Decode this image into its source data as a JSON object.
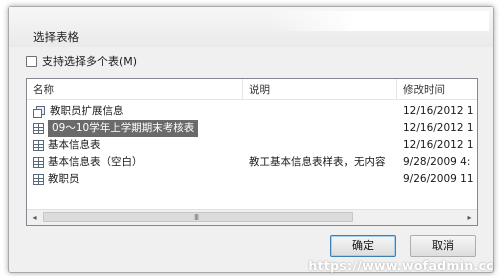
{
  "dialog": {
    "title": "选择表格",
    "multi_select_label": "支持选择多个表(M)",
    "multi_select_checked": false
  },
  "list": {
    "columns": [
      "名称",
      "说明",
      "修改时间"
    ],
    "rows": [
      {
        "icon": "linked-table-icon",
        "name": "教职员扩展信息",
        "desc": "",
        "modified": "12/16/2012 1",
        "selected": false
      },
      {
        "icon": "table-icon",
        "name": "09～10学年上学期期末考核表",
        "desc": "",
        "modified": "12/16/2012 1",
        "selected": true
      },
      {
        "icon": "table-icon",
        "name": "基本信息表",
        "desc": "",
        "modified": "12/16/2012 1",
        "selected": false
      },
      {
        "icon": "table-icon",
        "name": "基本信息表（空白）",
        "desc": "教工基本信息表样表，无内容",
        "modified": "9/28/2009 4:",
        "selected": false
      },
      {
        "icon": "table-icon",
        "name": "教职员",
        "desc": "",
        "modified": "9/26/2009 11",
        "selected": false
      }
    ]
  },
  "scrollbar": {
    "left_arrow": "◂",
    "right_arrow": "▸",
    "grip": "III"
  },
  "buttons": {
    "ok": "确定",
    "cancel": "取消"
  },
  "watermark": "https://www.wofadmin.cc"
}
